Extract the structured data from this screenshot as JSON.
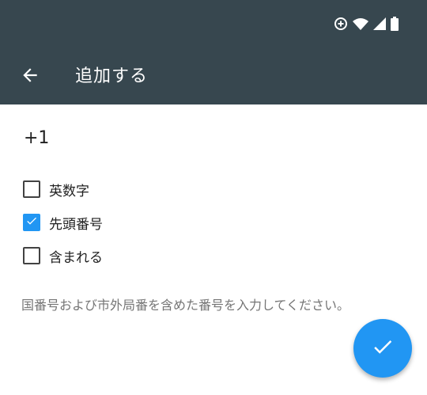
{
  "status_bar": {
    "icons": [
      "data-saver-icon",
      "wifi-icon",
      "signal-icon",
      "battery-icon"
    ]
  },
  "app_bar": {
    "title": "追加する",
    "back_icon": "arrow-left-icon",
    "background": "#37474f"
  },
  "form": {
    "number_value": "+1",
    "options": [
      {
        "label": "英数字",
        "checked": false
      },
      {
        "label": "先頭番号",
        "checked": true
      },
      {
        "label": "含まれる",
        "checked": false
      }
    ],
    "hint": "国番号および市外局番を含めた番号を入力してください。"
  },
  "fab": {
    "icon": "check-icon",
    "color": "#2196f3"
  }
}
